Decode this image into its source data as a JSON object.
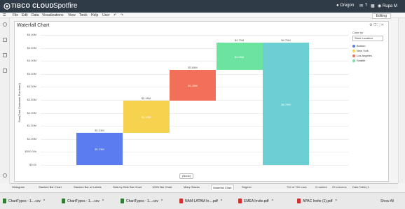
{
  "app": {
    "brand": "TIBCO CLOUD",
    "product": "Spotfire",
    "location": "Oregon",
    "user": "Rupa M",
    "mode": "Editing"
  },
  "menu": [
    "File",
    "Edit",
    "Data",
    "Visualizations",
    "View",
    "Tools",
    "Help",
    "User"
  ],
  "viz": {
    "title": "Waterfall Chart",
    "y_axis_title": "Sum(Total Customer Purchase)",
    "x_selector": "(None)"
  },
  "legend": {
    "heading": "Color by",
    "selector": "Store Location",
    "items": [
      {
        "label": "Boston",
        "color": "#5b7cf0"
      },
      {
        "label": "New York",
        "color": "#f6d24e"
      },
      {
        "label": "Los Angeles",
        "color": "#f2705a"
      },
      {
        "label": "Seattle",
        "color": "#6de3a0"
      }
    ]
  },
  "chart_data": {
    "type": "bar",
    "subtype": "waterfall",
    "title": "Waterfall Chart",
    "ylabel": "Sum(Total Customer Purchase)",
    "ylim": [
      0,
      5000000
    ],
    "y_ticks": [
      "$0.00",
      "$500.00k",
      "$1.00M",
      "$1.50M",
      "$2.00M",
      "$2.50M",
      "$3.00M",
      "$3.50M",
      "$4.00M",
      "$4.50M",
      "$5.00M"
    ],
    "series": [
      {
        "name": "Boston",
        "start": 0,
        "end": 1230000,
        "value_label": "$1.23M",
        "total_label": "$1.23M",
        "color": "#5b7cf0"
      },
      {
        "name": "New York",
        "start": 1230000,
        "end": 2460000,
        "value_label": "$1.23M",
        "total_label": "$2.46M",
        "color": "#f6d24e"
      },
      {
        "name": "Los Angeles",
        "start": 2460000,
        "end": 3650000,
        "value_label": "$1.19M",
        "total_label": "$3.65M",
        "color": "#f2705a"
      },
      {
        "name": "Seattle",
        "start": 3650000,
        "end": 4700000,
        "value_label": "$1.05M",
        "total_label": "$4.70M",
        "color": "#6de3a0"
      },
      {
        "name": "Total",
        "start": 0,
        "end": 4700000,
        "value_label": "$4.70M",
        "total_label": "$4.70M",
        "color": "#6ccfd3"
      }
    ]
  },
  "tabs": [
    "Histogram",
    "Stacked Bar Chart",
    "Stacked Bar w/ Labels",
    "Side-by-Side Bar Chart",
    "100% Bar Chart",
    "Many Stacks",
    "Waterfall Chart",
    "Segmer"
  ],
  "status": {
    "rows": "754 of 754 rows",
    "marked": "0 marked",
    "columns": "29 columns",
    "table": "Data Table (1"
  },
  "downloads": [
    {
      "label": "ChartTypes - 1....csv",
      "color": "#2e7d32"
    },
    {
      "label": "ChartTypes - 1....csv",
      "color": "#2e7d32"
    },
    {
      "label": "ChartTypes - 1....csv",
      "color": "#2e7d32"
    },
    {
      "label": "NAM-LATAM In....pdf",
      "color": "#d32f2f"
    },
    {
      "label": "EMEA Invite.pdf",
      "color": "#d32f2f"
    },
    {
      "label": "APAC Invite (1).pdf",
      "color": "#d32f2f"
    }
  ],
  "show_all": "Show All"
}
